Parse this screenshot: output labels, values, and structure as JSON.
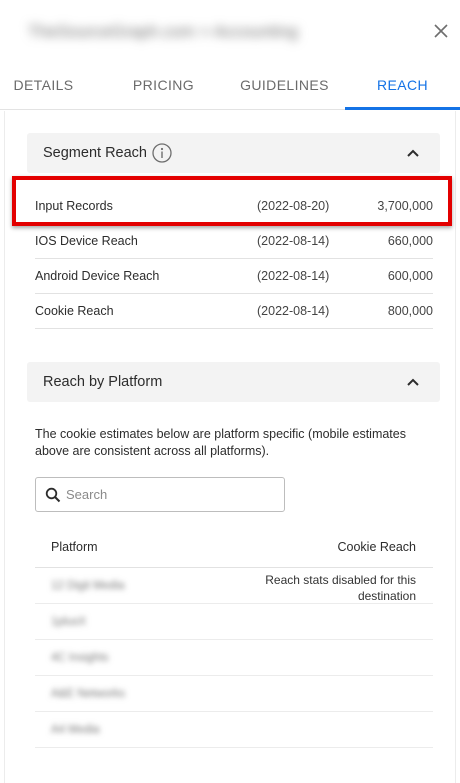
{
  "header": {
    "title": "TheSourceGraph.com > Accounting"
  },
  "tabs": [
    {
      "label": "DETAILS"
    },
    {
      "label": "PRICING"
    },
    {
      "label": "GUIDELINES"
    },
    {
      "label": "REACH",
      "active": true
    }
  ],
  "segment_reach": {
    "title": "Segment Reach",
    "rows": [
      {
        "name": "Input Records",
        "date": "(2022-08-20)",
        "value": "3,700,000"
      },
      {
        "name": "IOS Device Reach",
        "date": "(2022-08-14)",
        "value": "660,000"
      },
      {
        "name": "Android Device Reach",
        "date": "(2022-08-14)",
        "value": "600,000"
      },
      {
        "name": "Cookie Reach",
        "date": "(2022-08-14)",
        "value": "800,000"
      }
    ]
  },
  "reach_by_platform": {
    "title": "Reach by Platform",
    "description": "The cookie estimates below are platform specific (mobile estimates above are consistent across all platforms).",
    "search_placeholder": "Search",
    "columns": [
      "Platform",
      "Cookie Reach"
    ],
    "rows": [
      {
        "platform": "12 Digit Media",
        "note": "Reach stats disabled for this destination"
      },
      {
        "platform": "1plusX",
        "note": ""
      },
      {
        "platform": "4C Insights",
        "note": ""
      },
      {
        "platform": "A&E Networks",
        "note": ""
      },
      {
        "platform": "A4 Media",
        "note": ""
      }
    ]
  },
  "colors": {
    "accent": "#1473e6",
    "highlight": "#e30000",
    "section_bg": "#f3f3f3"
  }
}
